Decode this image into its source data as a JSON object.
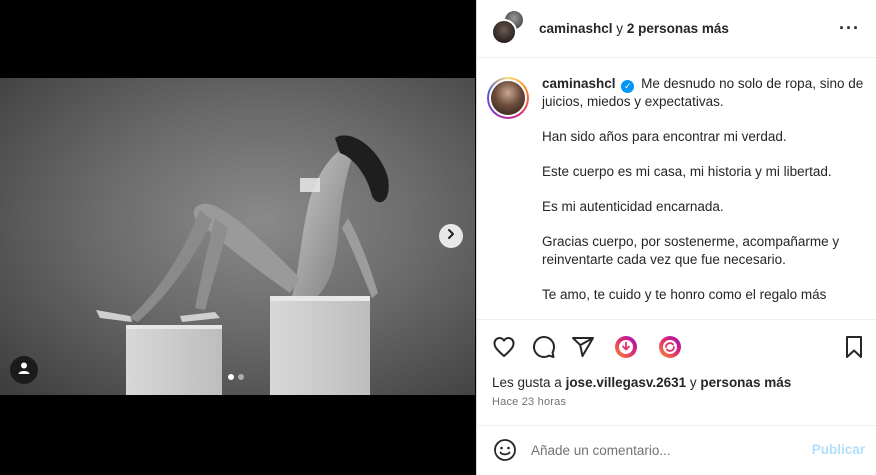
{
  "header": {
    "username": "caminashcl",
    "joiner": " y ",
    "others": "2 personas más",
    "more_icon": "more-horizontal-icon"
  },
  "caption": {
    "username": "caminashcl",
    "paragraphs": [
      "Me desnudo no solo de ropa, sino de juicios, miedos y expectativas.",
      "Han sido años para encontrar mi verdad.",
      "Este cuerpo es mi casa, mi historia y mi libertad.",
      "Es mi autenticidad encarnada.",
      "Gracias cuerpo, por sostenerme, acompañarme y reinventarte cada vez que fue necesario.",
      "Te amo, te cuido y te honro como el regalo más"
    ]
  },
  "actions": {
    "icons": [
      "heart-icon",
      "comment-icon",
      "share-icon",
      "sticker-icon",
      "remix-icon",
      "bookmark-icon"
    ]
  },
  "likes": {
    "prefix": "Les gusta a ",
    "user": "jose.villegasv.2631",
    "joiner": " y ",
    "others": "personas más"
  },
  "time": "Hace 23 horas",
  "comment": {
    "placeholder": "Añade un comentario...",
    "publish_label": "Publicar"
  },
  "carousel": {
    "total_slides": 2,
    "active_slide": 1
  },
  "colors": {
    "accent": "#0095f6",
    "publish_disabled": "#b2dffc",
    "secondary_text": "#737373"
  }
}
